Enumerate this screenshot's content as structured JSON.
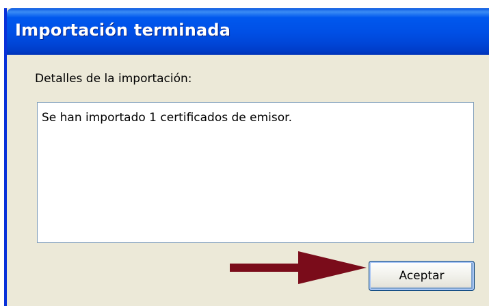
{
  "window": {
    "title": "Importación terminada"
  },
  "details": {
    "label": "Detalles de la importación:",
    "text": "Se han importado 1 certificados de emisor."
  },
  "buttons": {
    "ok_label": "Aceptar"
  },
  "colors": {
    "titlebar": "#0050e6",
    "dialog_background": "#ece9d8",
    "arrow": "#7a0c1a"
  },
  "annotation": {
    "icon": "arrow-right-icon"
  }
}
